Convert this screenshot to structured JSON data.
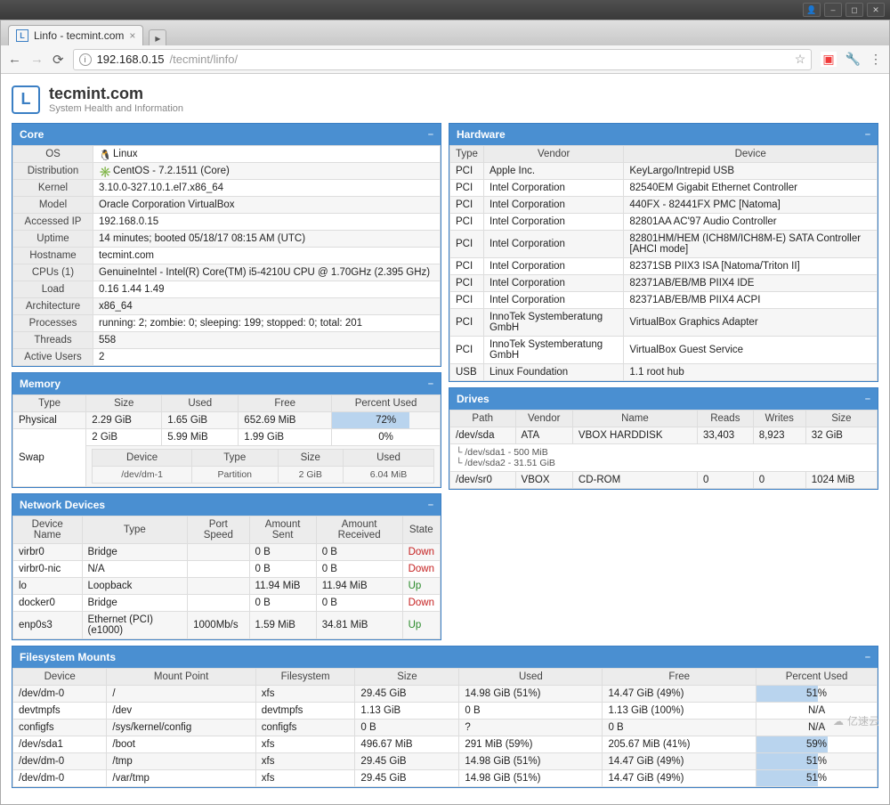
{
  "browser": {
    "tab_title": "Linfo - tecmint.com",
    "url_host": "192.168.0.15",
    "url_path": "/tecmint/linfo/"
  },
  "site": {
    "title": "tecmint.com",
    "subtitle": "System Health and Information",
    "logo_letter": "L"
  },
  "core": {
    "title": "Core",
    "rows": [
      {
        "k": "OS",
        "v": "Linux",
        "icon": "linux"
      },
      {
        "k": "Distribution",
        "v": "CentOS - 7.2.1511 (Core)",
        "icon": "centos"
      },
      {
        "k": "Kernel",
        "v": "3.10.0-327.10.1.el7.x86_64"
      },
      {
        "k": "Model",
        "v": "Oracle Corporation VirtualBox"
      },
      {
        "k": "Accessed IP",
        "v": "192.168.0.15"
      },
      {
        "k": "Uptime",
        "v": "14 minutes; booted 05/18/17 08:15 AM (UTC)"
      },
      {
        "k": "Hostname",
        "v": "tecmint.com"
      },
      {
        "k": "CPUs (1)",
        "v": "GenuineIntel - Intel(R) Core(TM) i5-4210U CPU @ 1.70GHz (2.395 GHz)"
      },
      {
        "k": "Load",
        "v": "0.16 1.44 1.49"
      },
      {
        "k": "Architecture",
        "v": "x86_64"
      },
      {
        "k": "Processes",
        "v": "running: 2; zombie: 0; sleeping: 199; stopped: 0; total: 201"
      },
      {
        "k": "Threads",
        "v": "558"
      },
      {
        "k": "Active Users",
        "v": "2"
      }
    ]
  },
  "memory": {
    "title": "Memory",
    "headers": [
      "Type",
      "Size",
      "Used",
      "Free",
      "Percent Used"
    ],
    "physical": {
      "type": "Physical",
      "size": "2.29 GiB",
      "used": "1.65 GiB",
      "free": "652.69 MiB",
      "pct": "72%",
      "pctn": 72
    },
    "swap": {
      "type": "Swap",
      "size": "2 GiB",
      "used": "5.99 MiB",
      "free": "1.99 GiB",
      "pct": "0%",
      "pctn": 0
    },
    "swap_sub_headers": [
      "Device",
      "Type",
      "Size",
      "Used"
    ],
    "swap_sub": {
      "device": "/dev/dm-1",
      "type": "Partition",
      "size": "2 GiB",
      "used": "6.04 MiB"
    }
  },
  "network": {
    "title": "Network Devices",
    "headers": [
      "Device Name",
      "Type",
      "Port Speed",
      "Amount Sent",
      "Amount Received",
      "State"
    ],
    "rows": [
      {
        "name": "virbr0",
        "type": "Bridge",
        "speed": "",
        "sent": "0 B",
        "recv": "0 B",
        "state": "Down"
      },
      {
        "name": "virbr0-nic",
        "type": "N/A",
        "speed": "",
        "sent": "0 B",
        "recv": "0 B",
        "state": "Down"
      },
      {
        "name": "lo",
        "type": "Loopback",
        "speed": "",
        "sent": "11.94 MiB",
        "recv": "11.94 MiB",
        "state": "Up"
      },
      {
        "name": "docker0",
        "type": "Bridge",
        "speed": "",
        "sent": "0 B",
        "recv": "0 B",
        "state": "Down"
      },
      {
        "name": "enp0s3",
        "type": "Ethernet (PCI) (e1000)",
        "speed": "1000Mb/s",
        "sent": "1.59 MiB",
        "recv": "34.81 MiB",
        "state": "Up"
      }
    ]
  },
  "hardware": {
    "title": "Hardware",
    "headers": [
      "Type",
      "Vendor",
      "Device"
    ],
    "rows": [
      {
        "t": "PCI",
        "v": "Apple Inc.",
        "d": "KeyLargo/Intrepid USB"
      },
      {
        "t": "PCI",
        "v": "Intel Corporation",
        "d": "82540EM Gigabit Ethernet Controller"
      },
      {
        "t": "PCI",
        "v": "Intel Corporation",
        "d": "440FX - 82441FX PMC [Natoma]"
      },
      {
        "t": "PCI",
        "v": "Intel Corporation",
        "d": "82801AA AC'97 Audio Controller"
      },
      {
        "t": "PCI",
        "v": "Intel Corporation",
        "d": "82801HM/HEM (ICH8M/ICH8M-E) SATA Controller [AHCI mode]"
      },
      {
        "t": "PCI",
        "v": "Intel Corporation",
        "d": "82371SB PIIX3 ISA [Natoma/Triton II]"
      },
      {
        "t": "PCI",
        "v": "Intel Corporation",
        "d": "82371AB/EB/MB PIIX4 IDE"
      },
      {
        "t": "PCI",
        "v": "Intel Corporation",
        "d": "82371AB/EB/MB PIIX4 ACPI"
      },
      {
        "t": "PCI",
        "v": "InnoTek Systemberatung GmbH",
        "d": "VirtualBox Graphics Adapter"
      },
      {
        "t": "PCI",
        "v": "InnoTek Systemberatung GmbH",
        "d": "VirtualBox Guest Service"
      },
      {
        "t": "USB",
        "v": "Linux Foundation",
        "d": "1.1 root hub"
      }
    ]
  },
  "drives": {
    "title": "Drives",
    "headers": [
      "Path",
      "Vendor",
      "Name",
      "Reads",
      "Writes",
      "Size"
    ],
    "rows": [
      {
        "path": "/dev/sda",
        "vendor": "ATA",
        "name": "VBOX HARDDISK",
        "reads": "33,403",
        "writes": "8,923",
        "size": "32 GiB",
        "parts": [
          "/dev/sda1 - 500 MiB",
          "/dev/sda2 - 31.51 GiB"
        ]
      },
      {
        "path": "/dev/sr0",
        "vendor": "VBOX",
        "name": "CD-ROM",
        "reads": "0",
        "writes": "0",
        "size": "1024 MiB"
      }
    ]
  },
  "fs": {
    "title": "Filesystem Mounts",
    "headers": [
      "Device",
      "Mount Point",
      "Filesystem",
      "Size",
      "Used",
      "Free",
      "Percent Used"
    ],
    "rows": [
      {
        "dev": "/dev/dm-0",
        "mp": "/",
        "fs": "xfs",
        "size": "29.45 GiB",
        "used": "14.98 GiB (51%)",
        "free": "14.47 GiB (49%)",
        "pct": "51%",
        "pctn": 51
      },
      {
        "dev": "devtmpfs",
        "mp": "/dev",
        "fs": "devtmpfs",
        "size": "1.13 GiB",
        "used": "0 B",
        "free": "1.13 GiB (100%)",
        "pct": "N/A"
      },
      {
        "dev": "configfs",
        "mp": "/sys/kernel/config",
        "fs": "configfs",
        "size": "0 B",
        "used": "?",
        "free": "0 B",
        "pct": "N/A"
      },
      {
        "dev": "/dev/sda1",
        "mp": "/boot",
        "fs": "xfs",
        "size": "496.67 MiB",
        "used": "291 MiB (59%)",
        "free": "205.67 MiB (41%)",
        "pct": "59%",
        "pctn": 59
      },
      {
        "dev": "/dev/dm-0",
        "mp": "/tmp",
        "fs": "xfs",
        "size": "29.45 GiB",
        "used": "14.98 GiB (51%)",
        "free": "14.47 GiB (49%)",
        "pct": "51%",
        "pctn": 51
      },
      {
        "dev": "/dev/dm-0",
        "mp": "/var/tmp",
        "fs": "xfs",
        "size": "29.45 GiB",
        "used": "14.98 GiB (51%)",
        "free": "14.47 GiB (49%)",
        "pct": "51%",
        "pctn": 51
      }
    ]
  },
  "watermark": "亿速云"
}
